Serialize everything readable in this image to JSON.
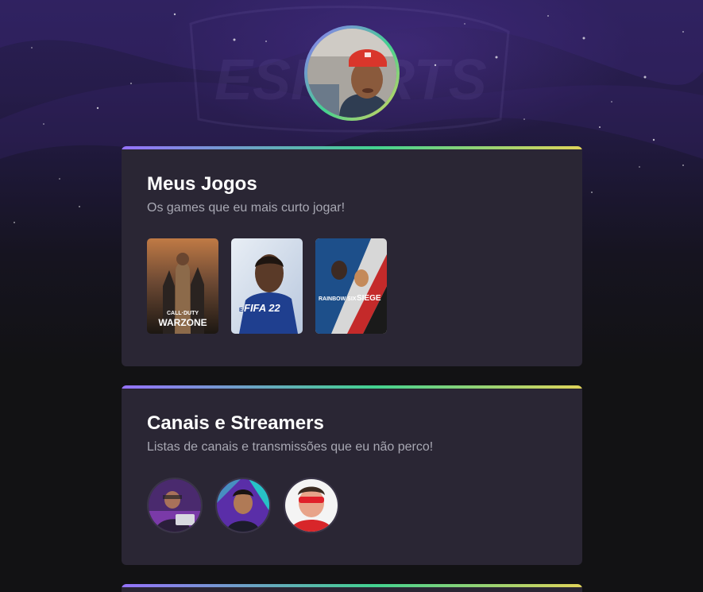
{
  "profile": {
    "avatar_icon": "profile-photo",
    "accent_gradient": [
      "#9572fc",
      "#43d290",
      "#e0d35a"
    ]
  },
  "sections": [
    {
      "title": "Meus Jogos",
      "subtitle": "Os games que eu mais curto jogar!",
      "games": [
        {
          "name": "Call of Duty Warzone",
          "cover_line1": "CALL·DUTY",
          "cover_line2": "WARZONE"
        },
        {
          "name": "FIFA 22",
          "cover_line1": "EA",
          "cover_line2": "FIFA 22"
        },
        {
          "name": "Rainbow Six Siege",
          "cover_line1": "RAINBOW SIX",
          "cover_line2": "SIEGE"
        }
      ]
    },
    {
      "title": "Canais e Streamers",
      "subtitle": "Listas de canais e transmissões que eu não perco!",
      "channels": [
        {
          "icon": "streamer-avatar-1"
        },
        {
          "icon": "streamer-avatar-2"
        },
        {
          "icon": "streamer-avatar-3"
        }
      ]
    }
  ],
  "colors": {
    "background": "#121214",
    "card": "#2a2634",
    "title": "#ffffff",
    "subtitle": "#a8a8b3"
  }
}
